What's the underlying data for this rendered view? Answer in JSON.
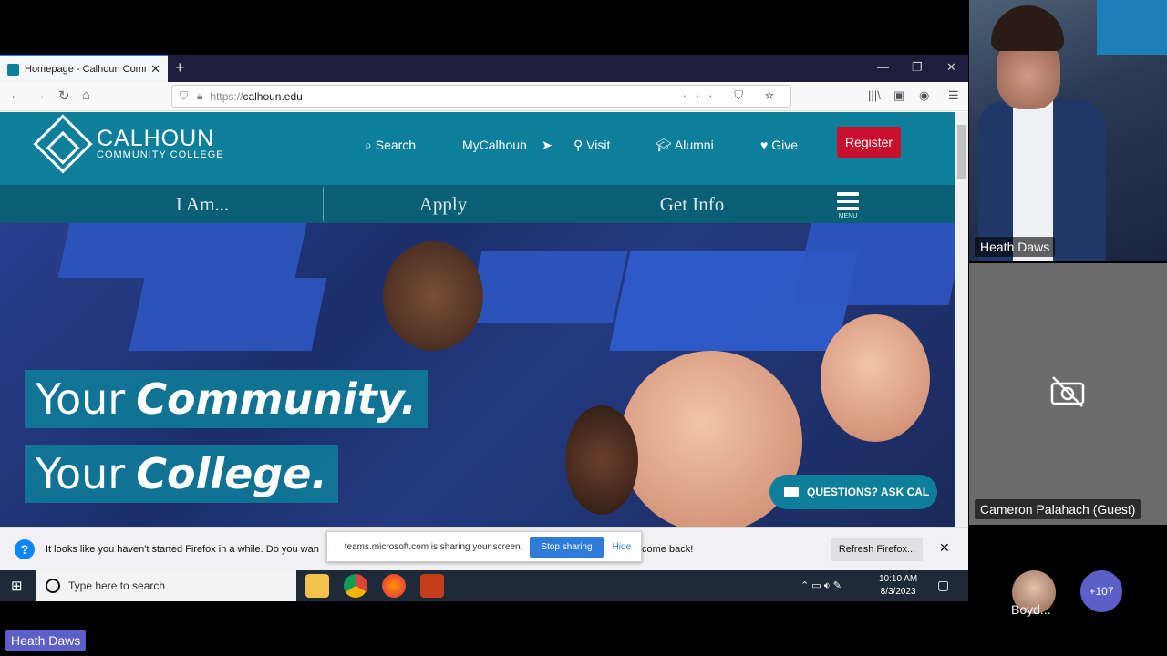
{
  "browser": {
    "tab_title": "Homepage - Calhoun Commun",
    "tab_close": "✕",
    "new_tab": "+",
    "url_prefix": "https://",
    "url_domain": "calhoun.edu",
    "url_icons": "··· ⛉ ☆"
  },
  "site": {
    "logo_line1": "CALHOUN",
    "logo_line2": "COMMUNITY COLLEGE",
    "nav": {
      "search": "Search",
      "mycalhoun": "MyCalhoun",
      "visit": "Visit",
      "alumni": "Alumni",
      "give": "Give",
      "register": "Register"
    },
    "subnav": {
      "i_am": "I Am...",
      "apply": "Apply",
      "get_info": "Get Info",
      "menu": "MENU"
    },
    "slogan1_pre": "Your",
    "slogan1_em": "Community.",
    "slogan2_pre": "Your",
    "slogan2_em": "College.",
    "chat_button": "QUESTIONS? ASK CAL"
  },
  "notification": {
    "message": "It looks like you haven't started Firefox in a while. Do you wan",
    "message_end": "come back!",
    "refresh_button": "Refresh Firefox...",
    "close": "✕"
  },
  "share_bar": {
    "text": "teams.microsoft.com is sharing your screen.",
    "stop_button": "Stop sharing",
    "hide_button": "Hide"
  },
  "taskbar": {
    "search_placeholder": "Type here to search",
    "time": "10:10 AM",
    "date": "8/3/2023"
  },
  "meeting": {
    "presenter_name": "Heath Daws",
    "guest_name": "Cameron Palahach (Guest)",
    "attendee_short": "Boyd...",
    "overflow_count": "+107",
    "bottom_name": "Heath Daws"
  },
  "colors": {
    "brand_teal": "#0e7f9b",
    "register_red": "#c8102e",
    "teams_purple": "#5b5fc7"
  }
}
